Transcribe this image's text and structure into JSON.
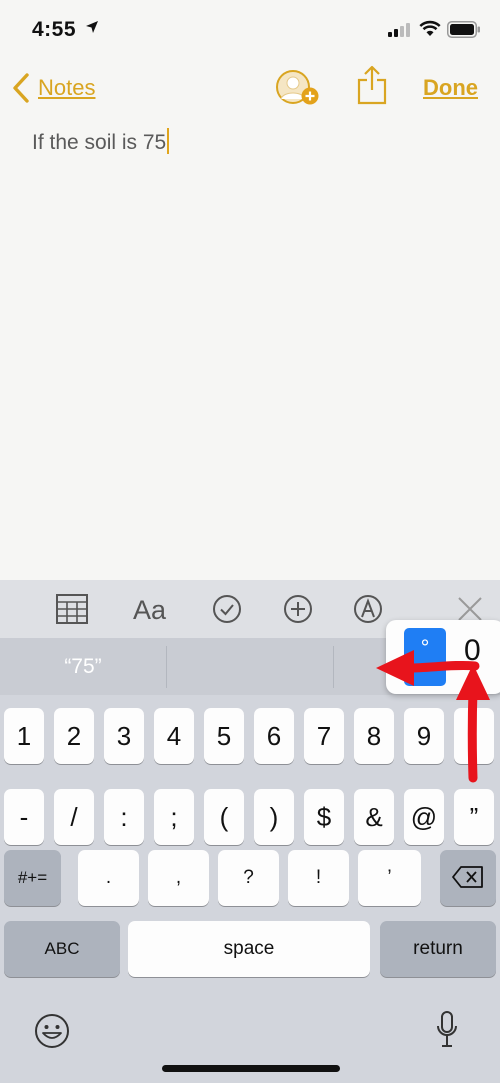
{
  "status_bar": {
    "time": "4:55"
  },
  "nav": {
    "back_label": "Notes",
    "done_label": "Done"
  },
  "note": {
    "text": "If the soil is 75"
  },
  "suggestions": [
    "“75”",
    "",
    ""
  ],
  "popup": {
    "selected": "°",
    "option": "0"
  },
  "keys": {
    "row1": [
      "1",
      "2",
      "3",
      "4",
      "5",
      "6",
      "7",
      "8",
      "9",
      "0"
    ],
    "row2": [
      "-",
      "/",
      ":",
      ";",
      "(",
      ")",
      "$",
      "&",
      "@",
      "”"
    ],
    "row3_mode": "#+=",
    "row3": [
      ".",
      ",",
      "?",
      "!",
      "’"
    ],
    "abc": "ABC",
    "space": "space",
    "return": "return"
  },
  "colors": {
    "accent": "#d9a521",
    "annotation_arrow": "#e8141c",
    "popup_selection": "#1f7ef4"
  }
}
